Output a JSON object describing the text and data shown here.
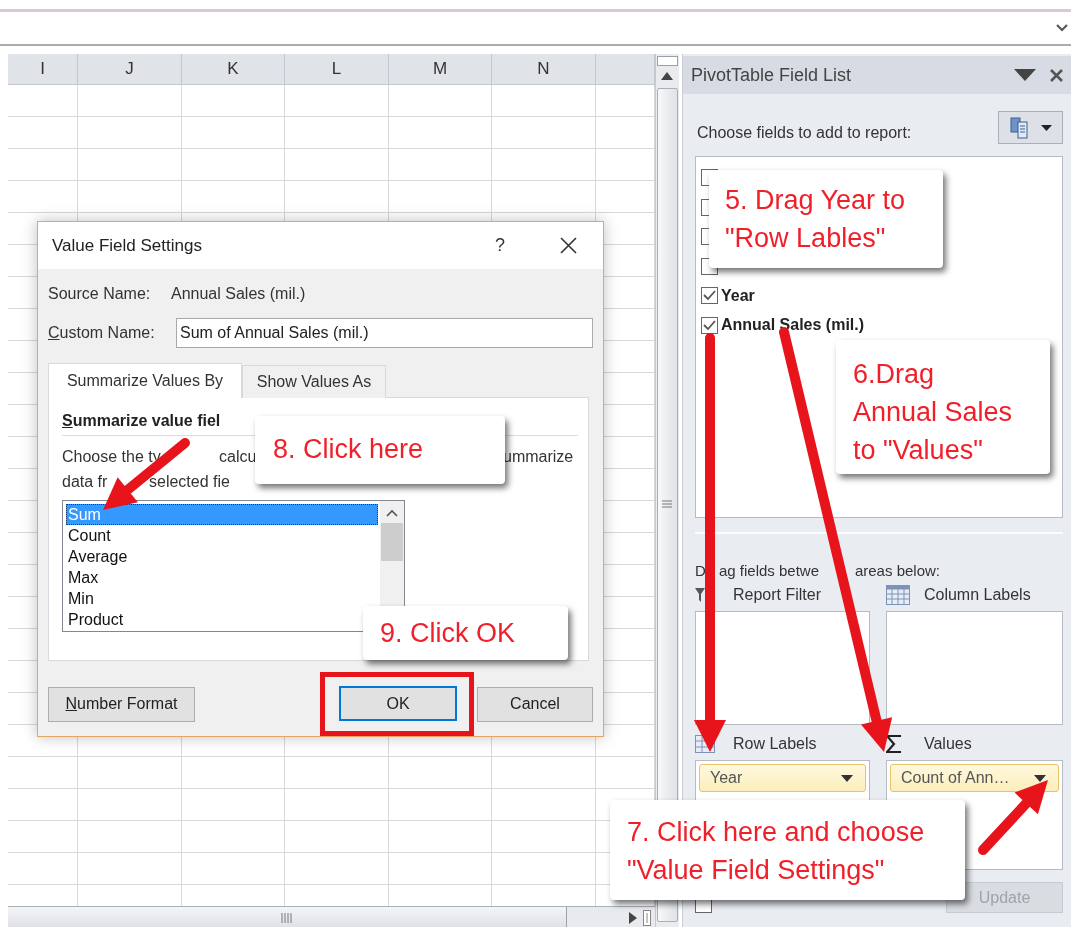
{
  "sheet": {
    "columns": [
      "I",
      "J",
      "K",
      "L",
      "M",
      "N"
    ]
  },
  "dialog": {
    "title": "Value Field Settings",
    "help": "?",
    "source_label": "Source Name:",
    "source_value": "Annual Sales (mil.)",
    "custom_label": {
      "text": "Custom Name:",
      "mnemonic": true
    },
    "custom_value": "Sum of Annual Sales (mil.)",
    "tabs": [
      {
        "label": "Summarize Values By",
        "selected": true
      },
      {
        "label": "Show Values As",
        "selected": false
      }
    ],
    "heading": {
      "text": "Summarize value fiel",
      "mnemonic": true
    },
    "description": [
      [
        "Choose the ty",
        "calcu",
        "ummarize"
      ],
      [
        "data fr",
        "selected fie"
      ]
    ],
    "functions": [
      {
        "label": "Sum",
        "selected": true
      },
      {
        "label": "Count",
        "selected": false
      },
      {
        "label": "Average",
        "selected": false
      },
      {
        "label": "Max",
        "selected": false
      },
      {
        "label": "Min",
        "selected": false
      },
      {
        "label": "Product",
        "selected": false
      }
    ],
    "buttons": [
      {
        "label": "Number Format",
        "kind": "plain",
        "mnemonic": true,
        "highlighted": false
      },
      {
        "label": "OK",
        "kind": "default",
        "highlighted": true
      },
      {
        "label": "Cancel",
        "kind": "plain",
        "highlighted": false
      }
    ]
  },
  "field_list": {
    "title": "PivotTable Field List",
    "choose_label": "Choose fields to add to report:",
    "fields": [
      {
        "checked": false
      },
      {
        "checked": false
      },
      {
        "checked": false
      },
      {
        "checked": false
      },
      {
        "label": "Year",
        "checked": true
      },
      {
        "label": "Annual Sales (mil.)",
        "checked": true
      }
    ],
    "drag_label": [
      "D",
      "ag fields betwe",
      "areas below:"
    ],
    "areas": [
      {
        "kind": "filter",
        "label": "Report Filter"
      },
      {
        "kind": "columns",
        "label": "Column Labels"
      },
      {
        "kind": "rows",
        "label": "Row Labels",
        "items": [
          "Year"
        ]
      },
      {
        "kind": "values",
        "label": "Values",
        "items": [
          "Count of Ann…"
        ]
      }
    ],
    "defer": {
      "checked": false
    },
    "update": {
      "label": "Update",
      "disabled": true
    }
  },
  "callouts": [
    {
      "text": "5. Drag Year to\n\"Row Lables\""
    },
    {
      "text": "8. Click here"
    },
    {
      "text": "6.Drag\nAnnual Sales\nto \"Values\""
    },
    {
      "text": "9. Click OK"
    },
    {
      "text": "7. Click here and choose\n\"Value Field Settings\""
    }
  ]
}
